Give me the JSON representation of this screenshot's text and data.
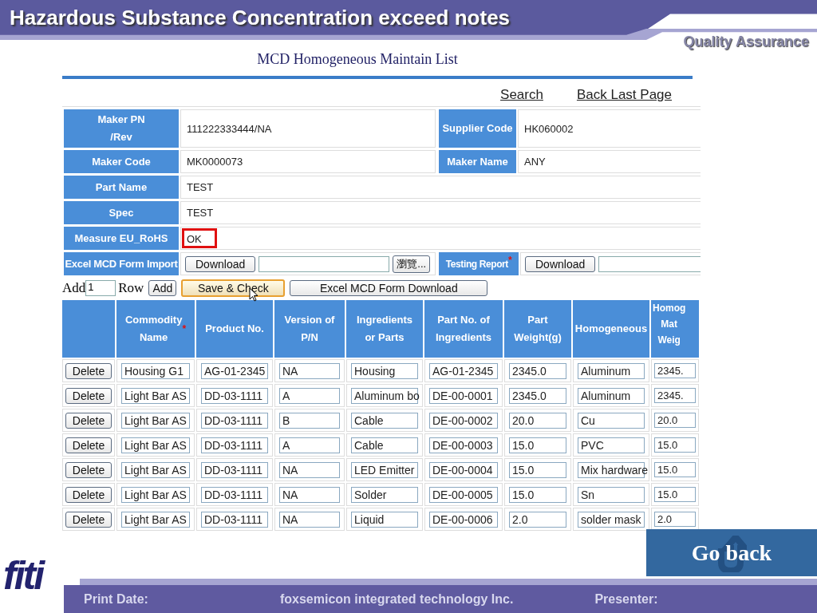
{
  "slide": {
    "title": "Hazardous Substance Concentration exceed notes",
    "section": "Quality Assurance",
    "logo": "fiti",
    "go_back": "Go back",
    "footer": {
      "print_date": "Print Date:",
      "company": "foxsemicon integrated technology Inc.",
      "presenter": "Presenter:"
    }
  },
  "page": {
    "title": "MCD Homogeneous Maintain List",
    "links": [
      "Search",
      "Back Last Page"
    ],
    "fields": [
      {
        "label": "Maker PN\n/Rev",
        "value": "111222333444/NA",
        "flagged": false,
        "label2": "Supplier Code",
        "value2": "HK060002"
      },
      {
        "label": "Maker Code",
        "value": "MK0000073",
        "flagged": false,
        "label2": "Maker Name",
        "value2": "ANY"
      },
      {
        "label": "Part Name",
        "value": "TEST",
        "flagged": false
      },
      {
        "label": "Spec",
        "value": "TEST",
        "flagged": false
      },
      {
        "label": "Measure EU_RoHS",
        "value": "OK",
        "flagged": true
      }
    ],
    "import_row": {
      "label": "Excel MCD Form Import",
      "button": "Download",
      "browse": "瀏覽...",
      "label2": "Testing Report",
      "required_mark": "*",
      "button2": "Download"
    },
    "add_row": {
      "prefix": "Add",
      "count": "1",
      "suffix": "Row",
      "add_button": "Add",
      "buttons": [
        {
          "label": "Save & Check",
          "selected": true
        },
        {
          "label": "Excel MCD Form Download",
          "selected": false
        }
      ]
    },
    "table": {
      "columns": [
        {
          "label": "Commodity\nName",
          "required_mark": "*"
        },
        {
          "label": "Product No."
        },
        {
          "label": "Version of P/N"
        },
        {
          "label": "Ingredients\nor Parts"
        },
        {
          "label": "Part No. of\nIngredients"
        },
        {
          "label": "Part\nWeight(g)"
        },
        {
          "label": "Homogeneous"
        },
        {
          "label": "Homog\nMat\nWeig"
        }
      ],
      "rows": [
        {
          "action": "Delete",
          "cells": [
            "Housing G1",
            "AG-01-2345",
            "NA",
            "Housing",
            "AG-01-2345",
            "2345.0",
            "Aluminum",
            "2345."
          ]
        },
        {
          "action": "Delete",
          "cells": [
            "Light Bar AS",
            "DD-03-1111",
            "A",
            "Aluminum bo",
            "DE-00-0001",
            "2345.0",
            "Aluminum",
            "2345."
          ]
        },
        {
          "action": "Delete",
          "cells": [
            "Light Bar AS",
            "DD-03-1111",
            "B",
            "Cable",
            "DE-00-0002",
            "20.0",
            "Cu",
            "20.0"
          ]
        },
        {
          "action": "Delete",
          "cells": [
            "Light Bar AS",
            "DD-03-1111",
            "A",
            "Cable",
            "DE-00-0003",
            "15.0",
            "PVC",
            "15.0"
          ]
        },
        {
          "action": "Delete",
          "cells": [
            "Light Bar AS",
            "DD-03-1111",
            "NA",
            "LED Emitter",
            "DE-00-0004",
            "15.0",
            "Mix hardware",
            "15.0"
          ]
        },
        {
          "action": "Delete",
          "cells": [
            "Light Bar AS",
            "DD-03-1111",
            "NA",
            "Solder",
            "DE-00-0005",
            "15.0",
            "Sn",
            "15.0"
          ]
        },
        {
          "action": "Delete",
          "cells": [
            "Light Bar AS",
            "DD-03-1111",
            "NA",
            "Liquid",
            "DE-00-0006",
            "2.0",
            "solder mask",
            "2.0"
          ]
        }
      ]
    }
  }
}
